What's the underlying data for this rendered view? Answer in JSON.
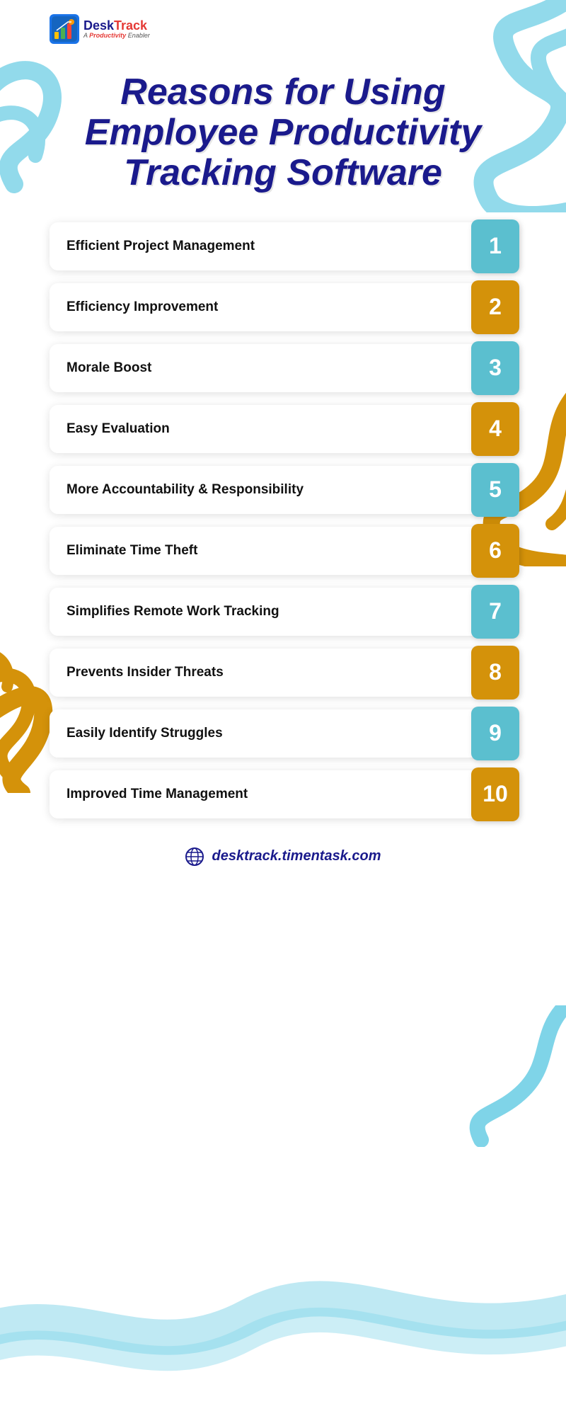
{
  "logo": {
    "title_part1": "Desk",
    "title_part2": "Track",
    "subtitle_pre": "A ",
    "subtitle_highlight": "Productivity",
    "subtitle_post": " Enabler"
  },
  "heading": {
    "line1": "Reasons for Using",
    "line2": "Employee Productivity",
    "line3": "Tracking Software"
  },
  "items": [
    {
      "id": 1,
      "label": "Efficient Project Management",
      "color": "blue"
    },
    {
      "id": 2,
      "label": "Efficiency Improvement",
      "color": "gold"
    },
    {
      "id": 3,
      "label": "Morale Boost",
      "color": "blue"
    },
    {
      "id": 4,
      "label": "Easy Evaluation",
      "color": "gold"
    },
    {
      "id": 5,
      "label": "More Accountability & Responsibility",
      "color": "blue"
    },
    {
      "id": 6,
      "label": "Eliminate Time Theft",
      "color": "gold"
    },
    {
      "id": 7,
      "label": "Simplifies Remote Work Tracking",
      "color": "blue"
    },
    {
      "id": 8,
      "label": "Prevents Insider Threats",
      "color": "gold"
    },
    {
      "id": 9,
      "label": "Easily Identify Struggles",
      "color": "blue"
    },
    {
      "id": 10,
      "label": "Improved Time Management",
      "color": "gold"
    }
  ],
  "footer": {
    "url": "desktrack.timentask.com"
  }
}
